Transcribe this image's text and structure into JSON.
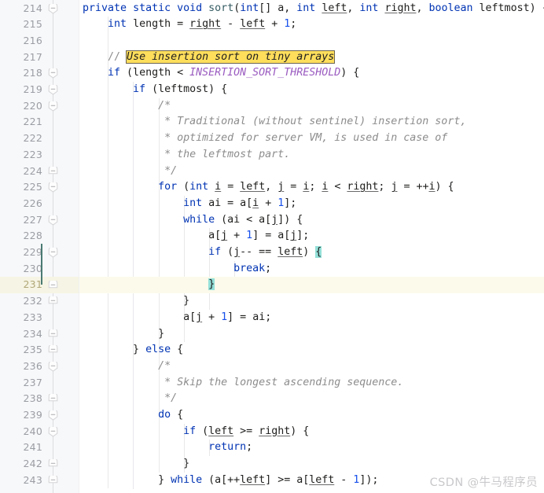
{
  "editor": {
    "language": "java",
    "first_line_number": 214,
    "current_line_number": 231,
    "line_height_px": 20.7,
    "colors": {
      "background": "#ffffff",
      "gutter_background": "#f7f8fa",
      "line_number": "#9a9da3",
      "keyword": "#0033b3",
      "number": "#1750eb",
      "comment": "#8c8c8c",
      "constant": "#9a5bc0",
      "method": "#355c63",
      "search_highlight": "#ffde5c",
      "brace_match_highlight": "#93e0d8",
      "current_line_highlight": "#fcfaeb",
      "vcs_modified_marker": "#4a7a72"
    },
    "highlighted_search_text": "Use insertion sort on tiny arrays",
    "lines": [
      {
        "n": 214,
        "fold": "collapse",
        "text": "private static void sort(int[] a, int left, int right, boolean leftmost) {"
      },
      {
        "n": 215,
        "fold": "none",
        "text": "    int length = right - left + 1;"
      },
      {
        "n": 216,
        "fold": "none",
        "text": ""
      },
      {
        "n": 217,
        "fold": "none",
        "text": "    // Use insertion sort on tiny arrays"
      },
      {
        "n": 218,
        "fold": "collapse",
        "text": "    if (length < INSERTION_SORT_THRESHOLD) {"
      },
      {
        "n": 219,
        "fold": "collapse",
        "text": "        if (leftmost) {"
      },
      {
        "n": 220,
        "fold": "collapse",
        "text": "            /*"
      },
      {
        "n": 221,
        "fold": "none",
        "text": "             * Traditional (without sentinel) insertion sort,"
      },
      {
        "n": 222,
        "fold": "none",
        "text": "             * optimized for server VM, is used in case of"
      },
      {
        "n": 223,
        "fold": "none",
        "text": "             * the leftmost part."
      },
      {
        "n": 224,
        "fold": "expand",
        "text": "             */"
      },
      {
        "n": 225,
        "fold": "collapse",
        "text": "            for (int i = left, j = i; i < right; j = ++i) {"
      },
      {
        "n": 226,
        "fold": "none",
        "text": "                int ai = a[i + 1];"
      },
      {
        "n": 227,
        "fold": "collapse",
        "text": "                while (ai < a[j]) {"
      },
      {
        "n": 228,
        "fold": "none",
        "text": "                    a[j + 1] = a[j];"
      },
      {
        "n": 229,
        "fold": "collapse",
        "text": "                    if (j-- == left) {"
      },
      {
        "n": 230,
        "fold": "none",
        "text": "                        break;"
      },
      {
        "n": 231,
        "fold": "expand",
        "text": "                    }"
      },
      {
        "n": 232,
        "fold": "expand",
        "text": "                }"
      },
      {
        "n": 233,
        "fold": "none",
        "text": "                a[j + 1] = ai;"
      },
      {
        "n": 234,
        "fold": "expand",
        "text": "            }"
      },
      {
        "n": 235,
        "fold": "expand",
        "text": "        } else {"
      },
      {
        "n": 236,
        "fold": "collapse",
        "text": "            /*"
      },
      {
        "n": 237,
        "fold": "none",
        "text": "             * Skip the longest ascending sequence."
      },
      {
        "n": 238,
        "fold": "expand",
        "text": "             */"
      },
      {
        "n": 239,
        "fold": "collapse",
        "text": "            do {"
      },
      {
        "n": 240,
        "fold": "collapse",
        "text": "                if (left >= right) {"
      },
      {
        "n": 241,
        "fold": "none",
        "text": "                    return;"
      },
      {
        "n": 242,
        "fold": "expand",
        "text": "                }"
      },
      {
        "n": 243,
        "fold": "expand",
        "text": "            } while (a[++left] >= a[left - 1]);"
      }
    ]
  },
  "watermark": {
    "text": "CSDN @牛马程序员"
  }
}
